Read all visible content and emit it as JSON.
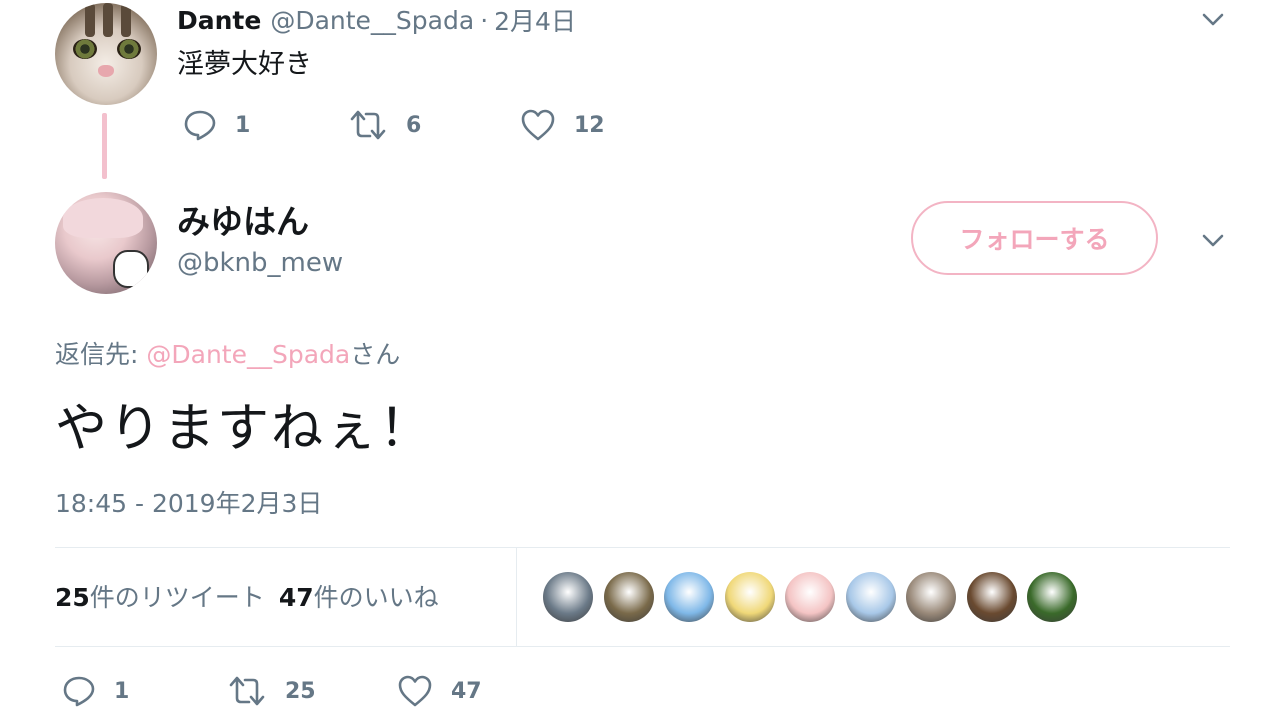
{
  "parent_tweet": {
    "name": "Dante",
    "handle": "@Dante__Spada",
    "separator": "·",
    "date": "2月4日",
    "text": "淫夢大好き",
    "replies": "1",
    "retweets": "6",
    "likes": "12"
  },
  "main_tweet": {
    "name": "みゆはん",
    "handle": "@bknb_mew",
    "follow_label": "フォローする",
    "reply_prefix": "返信先: ",
    "reply_mention": "@Dante__Spada",
    "reply_suffix": "さん",
    "text": "やりますねぇ！",
    "timestamp": "18:45 - 2019年2月3日",
    "retweet_count": "25",
    "retweet_label": "件のリツイート",
    "like_count": "47",
    "like_label": "件のいいね",
    "replies": "1",
    "retweets": "25",
    "likes": "47"
  },
  "liker_avatars": [
    {
      "icon": "avatar-landscape",
      "color": "#6b7a88"
    },
    {
      "icon": "avatar-25-badge",
      "color": "#7a6a4a"
    },
    {
      "icon": "avatar-blue-hair-anime",
      "color": "#7fb8e8"
    },
    {
      "icon": "avatar-blonde-anime",
      "color": "#f0d878"
    },
    {
      "icon": "avatar-pink-character",
      "color": "#f4c4c4"
    },
    {
      "icon": "avatar-white-hair-anime",
      "color": "#a8c8e8"
    },
    {
      "icon": "avatar-cat",
      "color": "#9a8a7a"
    },
    {
      "icon": "avatar-man",
      "color": "#6a4a30"
    },
    {
      "icon": "avatar-cartoon",
      "color": "#3a6a2a"
    }
  ],
  "colors": {
    "accent_pink": "#f3a6ba",
    "secondary_text": "#657786",
    "primary_text": "#14171a",
    "thread_line": "#f3c0cd"
  }
}
